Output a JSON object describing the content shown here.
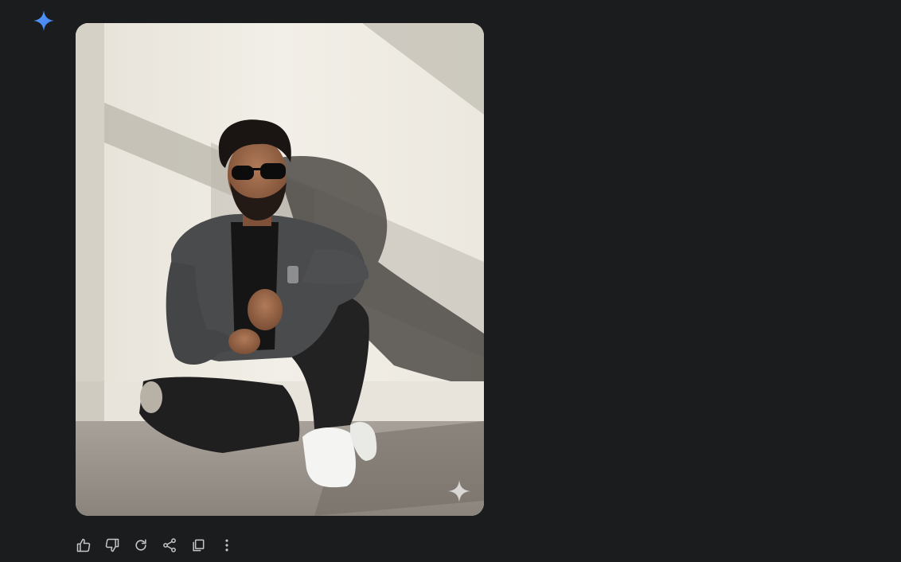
{
  "response": {
    "avatar_icon": "gemini-sparkle-icon",
    "image": {
      "alt": "",
      "watermark_icon": "sparkle-watermark-icon"
    }
  },
  "toolbar": {
    "buttons": [
      {
        "icon": "thumbs-up-icon"
      },
      {
        "icon": "thumbs-down-icon"
      },
      {
        "icon": "regenerate-icon"
      },
      {
        "icon": "share-icon"
      },
      {
        "icon": "copy-icon"
      },
      {
        "icon": "more-vertical-icon"
      }
    ]
  },
  "colors": {
    "background": "#1b1c1e",
    "spark_blue": "#4a8cf7",
    "icon_gray": "#c4c7c5"
  }
}
